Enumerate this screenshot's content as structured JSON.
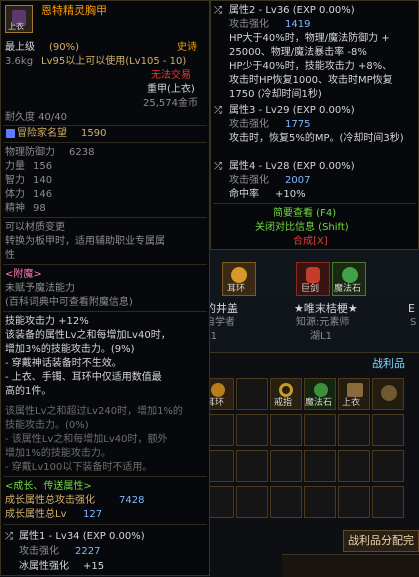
{
  "left_tooltip": {
    "title": "恩特精灵胸甲",
    "icon_badge": "上衣",
    "level_tag": "最上级",
    "level_pct": "(90%)",
    "rarity": "史诗",
    "weight": "3.6kg",
    "level_req": "Lv95以上可以使用(Lv105 - 10)",
    "trade": "无法交易",
    "slot_type": "重甲(上衣)",
    "price": "25,574金币",
    "durability": "耐久度 40/40",
    "reputation_label": "冒险家名望",
    "reputation_value": "1590",
    "stats": [
      {
        "label": "物理防御力",
        "value": "6238"
      },
      {
        "label": "力量",
        "value": "156"
      },
      {
        "label": "智力",
        "value": "140"
      },
      {
        "label": "体力",
        "value": "146"
      },
      {
        "label": "精神",
        "value": "98"
      }
    ],
    "material_change": "可以材质变更",
    "convert_line1": "转换为板甲时，适用辅助职业专属属",
    "convert_line2": "性",
    "enchant_header": "<附魔>",
    "enchant_none": "未赋予魔法能力",
    "enchant_hint": "(百科词典中可查看附魔信息)",
    "skill_lines": [
      "技能攻击力 +12%",
      "该装备的属性Lv之和每增加Lv40时，",
      "增加3%的技能攻击力。(9%)",
      "- 穿戴神话装备时不生效。",
      "- 上衣、手镯、耳环中仅适用数值最",
      "高的1件。"
    ],
    "skill_dim_lines": [
      "该属性Lv之和超过Lv240时，增加1%的",
      "技能攻击力。(0%)",
      "- 该属性Lv之和每增加Lv40时，额外",
      "增加1%的技能攻击力。",
      "- 穿戴Lv100以下装备时不适用。"
    ],
    "growth_header": "<成长、传送属性>",
    "growth_total_label": "成长属性总攻击强化",
    "growth_total_value": "7428",
    "growth_lv_label": "成长属性总Lv",
    "growth_lv_value": "127",
    "attr1_title": "属性1 - Lv34 (EXP 0.00%)",
    "attr1_line1_label": "攻击强化",
    "attr1_line1_value": "2227",
    "attr1_line2_label": "冰属性强化",
    "attr1_line2_value": "+15"
  },
  "right_tooltip": {
    "attr2_title": "属性2 - Lv36 (EXP 0.00%)",
    "attr2_atk_label": "攻击强化",
    "attr2_atk_value": "1419",
    "attr2_lines": [
      "HP大于40%时，物理/魔法防御力 +",
      "25000、物理/魔法暴击率 -8%",
      "HP少于40%时，技能攻击力 +8%、",
      "攻击时HP恢复1000、攻击时MP恢复",
      "1750 (冷却时间1秒)"
    ],
    "attr3_title": "属性3 - Lv29 (EXP 0.00%)",
    "attr3_atk_label": "攻击强化",
    "attr3_atk_value": "1775",
    "attr3_line": "攻击时，恢复5%的MP。(冷却时间3秒)",
    "attr4_title": "属性4 - Lv28 (EXP 0.00%)",
    "attr4_atk_label": "攻击强化",
    "attr4_atk_value": "2007",
    "attr4_hit_label": "命中率",
    "attr4_hit_value": "+10%",
    "view_brief": "简要查看 (F4)",
    "close_compare": "关闭对比信息 (Shift)",
    "synthesis": "合成[X]"
  },
  "background": {
    "top_icons": [
      {
        "label": "耳环",
        "color": "#d79a2a"
      },
      {
        "label": "巨剑",
        "color": "#c43c2a"
      },
      {
        "label": "魔法石",
        "color": "#3fa34a"
      }
    ],
    "name_left_1": "的井盖",
    "name_left_2": "自学者",
    "name_left_3": "L1",
    "name_right_1": "★唯末桔梗★",
    "name_right_2": "知源:元素师",
    "name_right_3": "湖L1",
    "side_letter_1": "E",
    "side_letter_2": "S",
    "loot_title": "战利品",
    "loot_items": [
      {
        "label": "耳环",
        "color": "#b97d1e"
      },
      {
        "label": "戒指",
        "color": "#c89a2a"
      },
      {
        "label": "魔法石",
        "color": "#3e8f3b"
      },
      {
        "label": "上衣",
        "color": "#8a6a3a"
      },
      {
        "label": "",
        "color": "#6e5a2e"
      },
      {
        "label": "二链",
        "color": "#a88a4a"
      },
      {
        "label": "",
        "color": "#8a5a2a"
      }
    ],
    "distribute_button": "战利品分配完"
  },
  "colors": {
    "accent": "#ff9d00",
    "gold": "#d5b069",
    "rare_red": "#e73b32",
    "link": "#7fd8ff"
  }
}
